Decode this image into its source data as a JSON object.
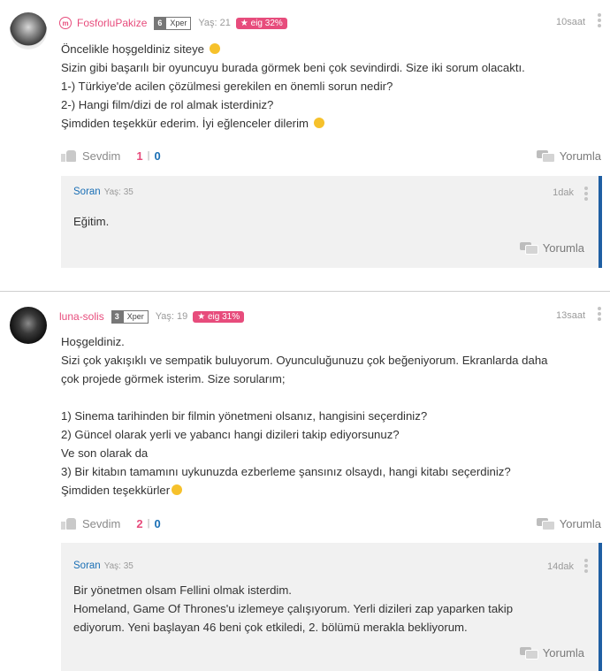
{
  "comments": [
    {
      "username": "FosforluPakize",
      "level": "6",
      "level_label": "Xper",
      "age": "Yaş: 21",
      "eig": "★ eig 32%",
      "time": "10saat",
      "lines": [
        "Öncelikle hoşgeldiniz siteye",
        "Sizin gibi başarılı bir oyuncuyu burada görmek beni çok sevindirdi. Size iki sorum olacaktı.",
        "1-) Türkiye'de acilen çözülmesi gerekilen en önemli sorun nedir?",
        "2-) Hangi film/dizi de rol almak isterdiniz?",
        "Şimdiden teşekkür ederim. İyi eğlenceler dilerim"
      ],
      "sevdim": "Sevdim",
      "likes": "1",
      "dislikes": "0",
      "reply_label": "Yorumla",
      "reply": {
        "name": "Soran",
        "age": "Yaş: 35",
        "time": "1dak",
        "lines": [
          "Eğitim."
        ],
        "reply_label": "Yorumla"
      }
    },
    {
      "username": "luna-solis",
      "level": "3",
      "level_label": "Xper",
      "age": "Yaş: 19",
      "eig": "★ eig 31%",
      "time": "13saat",
      "lines": [
        "Hoşgeldiniz.",
        "Sizi çok yakışıklı ve sempatik buluyorum. Oyunculuğunuzu çok beğeniyorum. Ekranlarda daha",
        "çok projede görmek isterim. Size sorularım;",
        "",
        "1) Sinema tarihinden bir filmin yönetmeni olsanız, hangisini seçerdiniz?",
        "2) Güncel olarak yerli ve yabancı hangi dizileri takip ediyorsunuz?",
        "Ve son olarak da",
        "3) Bir kitabın tamamını uykunuzda ezberleme şansınız olsaydı, hangi kitabı seçerdiniz?",
        "Şimdiden teşekkürler"
      ],
      "sevdim": "Sevdim",
      "likes": "2",
      "dislikes": "0",
      "reply_label": "Yorumla",
      "reply": {
        "name": "Soran",
        "age": "Yaş: 35",
        "time": "14dak",
        "lines": [
          "Bir yönetmen olsam Fellini olmak isterdim.",
          "Homeland, Game Of Thrones'u izlemeye çalışıyorum. Yerli dizileri zap yaparken takip",
          "ediyorum. Yeni başlayan 46 beni çok etkiledi, 2. bölümü merakla bekliyorum."
        ],
        "reply_label": "Yorumla"
      }
    }
  ],
  "colors": {
    "pink": "#e74c7c",
    "blue": "#1a6fb5",
    "reply_border": "#1f5fa3",
    "reply_bg": "#f1f1f1"
  },
  "icons": [
    "m-badge-icon",
    "like-icon",
    "chat-icon",
    "more-icon",
    "smile-emoji-icon"
  ]
}
